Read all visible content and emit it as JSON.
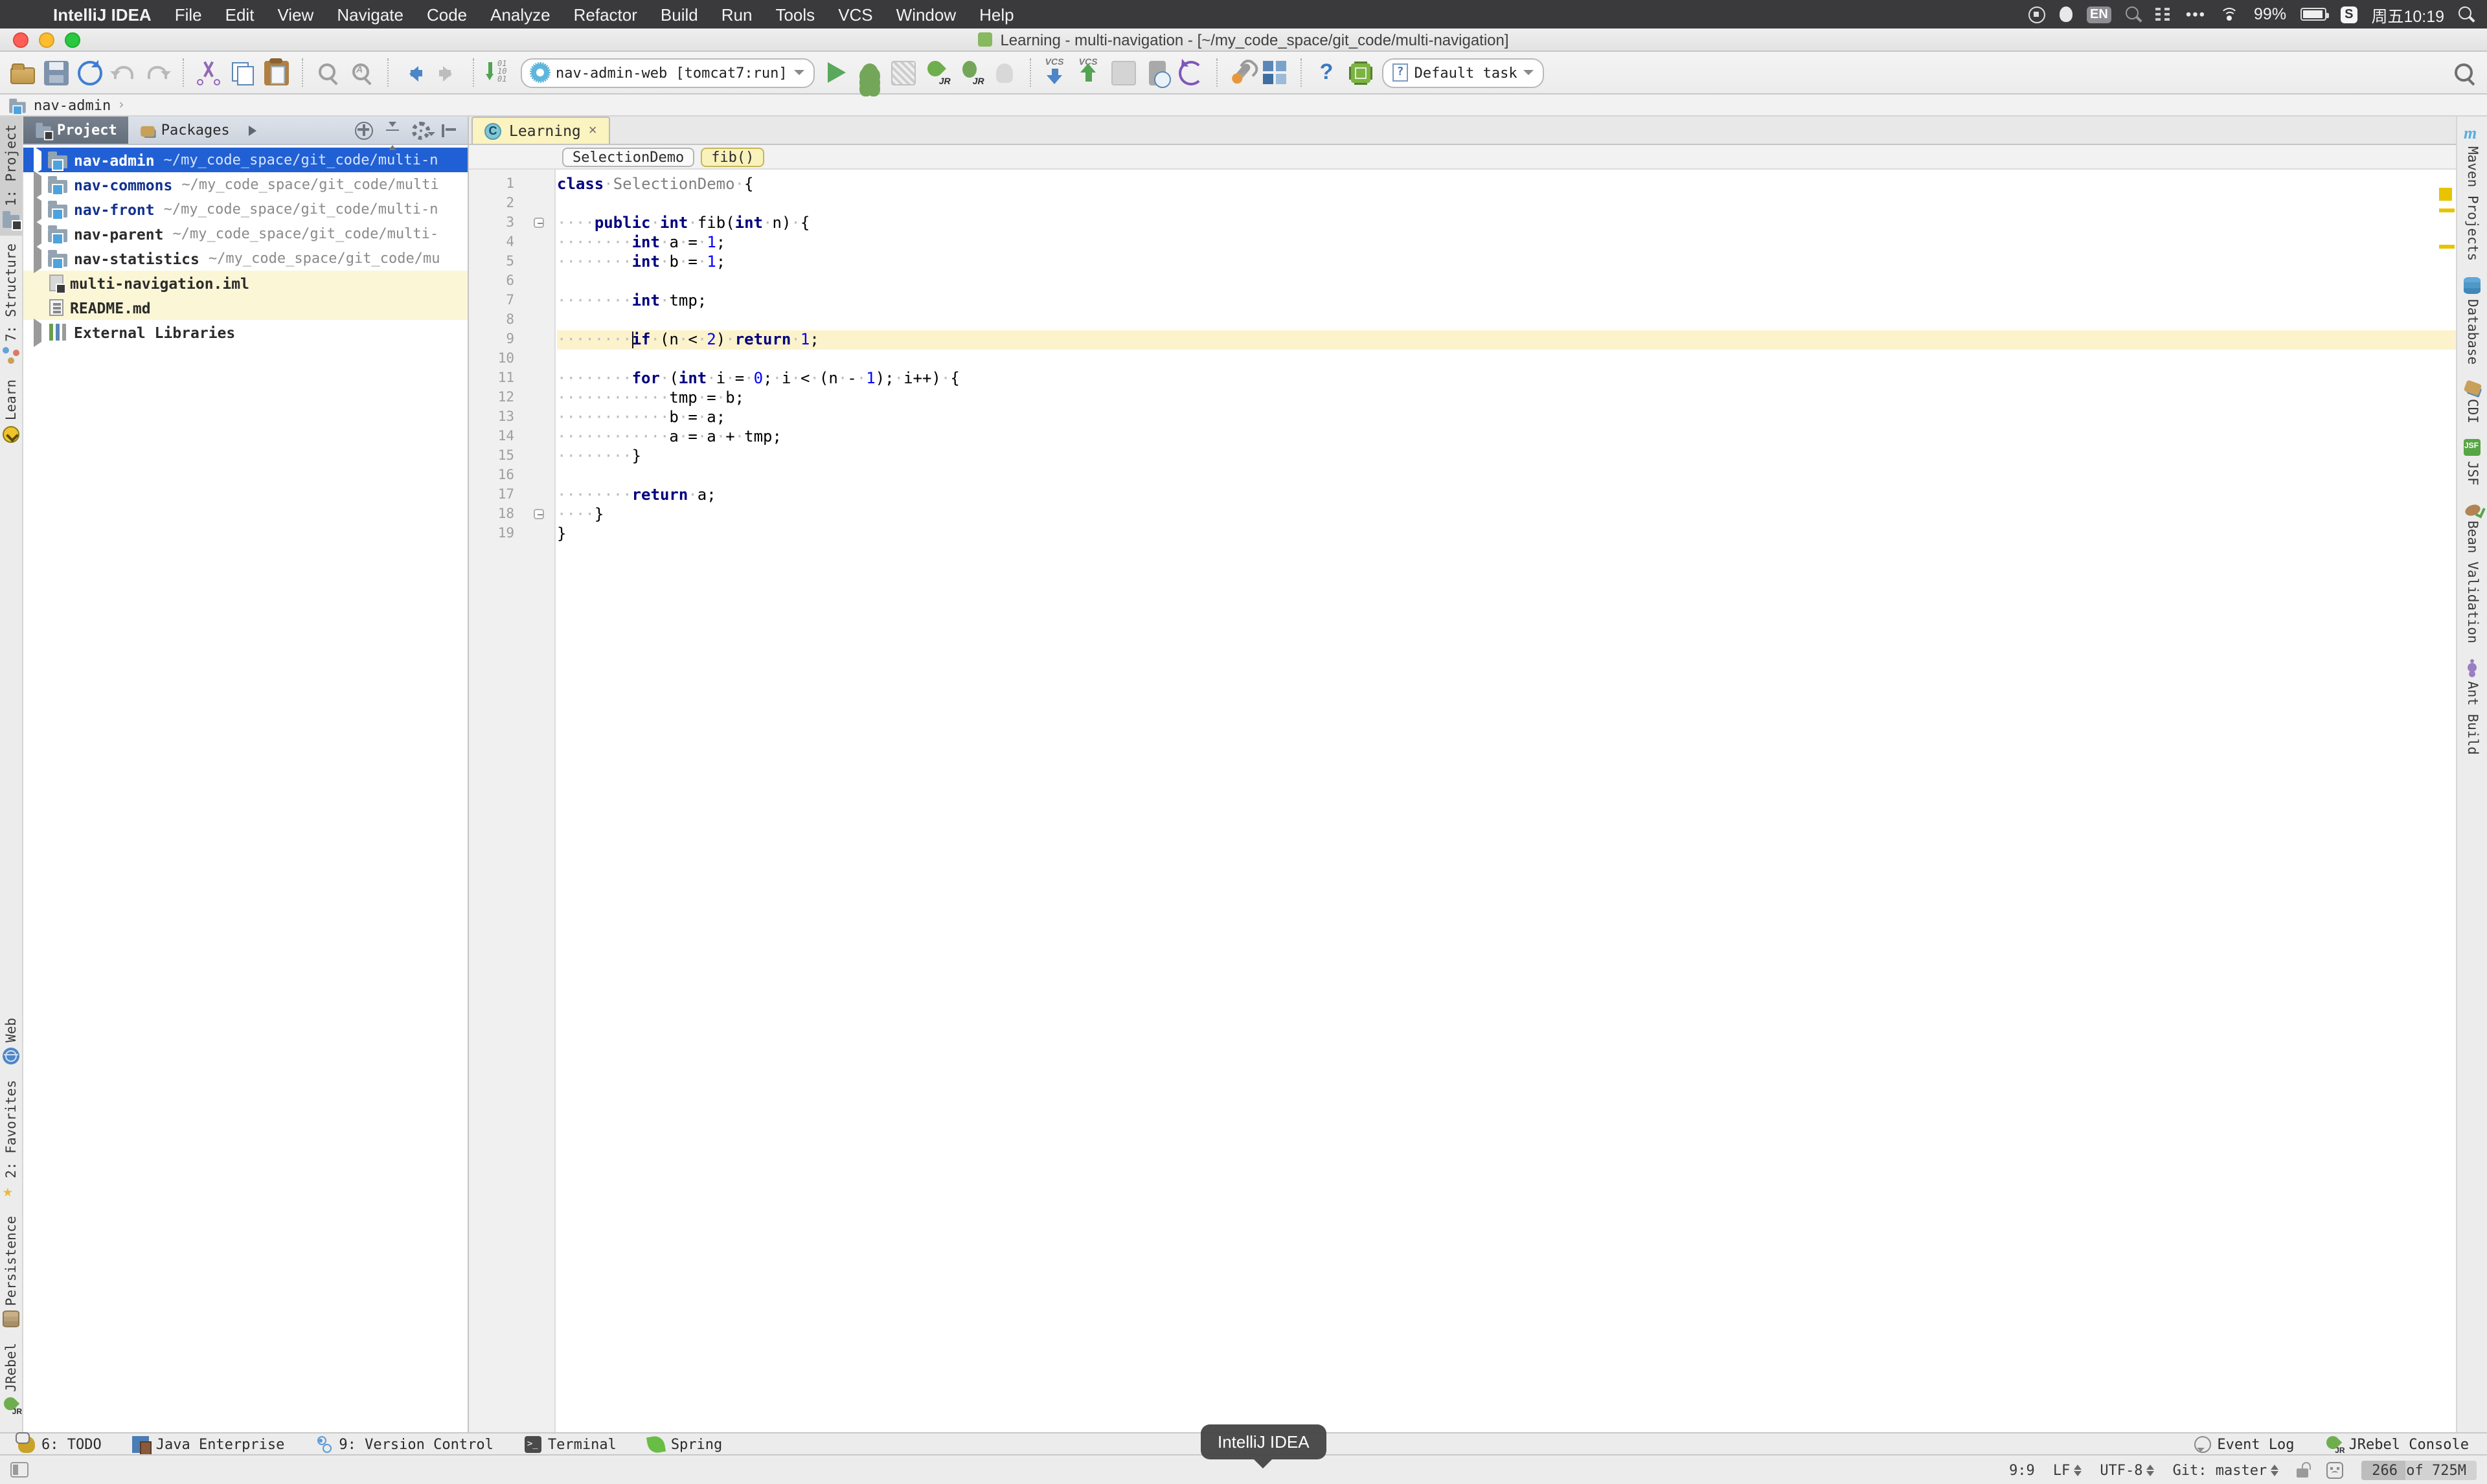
{
  "menubar": {
    "apple": "",
    "items": [
      "IntelliJ IDEA",
      "File",
      "Edit",
      "View",
      "Navigate",
      "Code",
      "Analyze",
      "Refactor",
      "Build",
      "Run",
      "Tools",
      "VCS",
      "Window",
      "Help"
    ],
    "status": {
      "input_badge": "EN",
      "more_dots": "•••",
      "battery_percent": "99%",
      "ime_badge": "S",
      "clock": "周五10:19"
    }
  },
  "titlebar": {
    "title": "Learning - multi-navigation - [~/my_code_space/git_code/multi-navigation]"
  },
  "toolbar": {
    "run_config_label": "nav-admin-web [tomcat7:run]",
    "task_selector_label": "Default task",
    "left_icons": [
      "open",
      "save",
      "sync",
      "undo",
      "redo",
      "|",
      "cut",
      "copy",
      "paste",
      "|",
      "find",
      "replace",
      "|",
      "back",
      "forward",
      "|",
      "sort"
    ],
    "run_icons": [
      "run",
      "debug",
      "coverage",
      "jrebel-run",
      "jrebel-debug",
      "profile-disabled",
      "|",
      "vcs-update",
      "vcs-commit",
      "vcs-disabled",
      "history",
      "rollback",
      "|",
      "settings",
      "project-structure",
      "|",
      "help",
      "memory-chip"
    ]
  },
  "navbar": {
    "path": "nav-admin",
    "chevron": "›"
  },
  "project_panel": {
    "tabs": [
      {
        "label": "Project",
        "selected": true
      },
      {
        "label": "Packages",
        "selected": false
      }
    ],
    "tree": [
      {
        "type": "module",
        "name": "nav-admin",
        "path": "~/my_code_space/git_code/multi-n",
        "selected": true,
        "arrow": true
      },
      {
        "type": "module",
        "name": "nav-commons",
        "path": "~/my_code_space/git_code/multi",
        "name_color": "blue",
        "arrow": true
      },
      {
        "type": "module",
        "name": "nav-front",
        "path": "~/my_code_space/git_code/multi-n",
        "name_color": "blue",
        "arrow": true
      },
      {
        "type": "module",
        "name": "nav-parent",
        "path": "~/my_code_space/git_code/multi-",
        "arrow": true
      },
      {
        "type": "module",
        "name": "nav-statistics",
        "path": "~/my_code_space/git_code/mu",
        "arrow": true
      },
      {
        "type": "iml",
        "name": "multi-navigation.iml",
        "path": "",
        "highlighted": true
      },
      {
        "type": "md",
        "name": "README.md",
        "path": "",
        "highlighted": true
      },
      {
        "type": "lib",
        "name": "External Libraries",
        "path": "",
        "arrow": true
      }
    ]
  },
  "editor": {
    "tab": {
      "label": "Learning",
      "close": "×",
      "class_letter": "C"
    },
    "breadcrumbs": [
      "SelectionDemo",
      "fib()"
    ],
    "code_lines": [
      {
        "n": "1",
        "seg": [
          [
            "k",
            "class"
          ],
          [
            "w",
            "·"
          ],
          [
            "g",
            "SelectionDemo"
          ],
          [
            "w",
            "·"
          ],
          [
            "d",
            "{"
          ]
        ]
      },
      {
        "n": "2",
        "seg": []
      },
      {
        "n": "3",
        "fold": true,
        "seg": [
          [
            "w",
            "····"
          ],
          [
            "k",
            "public"
          ],
          [
            "w",
            "·"
          ],
          [
            "k",
            "int"
          ],
          [
            "w",
            "·"
          ],
          [
            "d",
            "fib("
          ],
          [
            "k",
            "int"
          ],
          [
            "w",
            "·"
          ],
          [
            "d",
            "n)"
          ],
          [
            "w",
            "·"
          ],
          [
            "d",
            "{"
          ]
        ]
      },
      {
        "n": "4",
        "seg": [
          [
            "w",
            "········"
          ],
          [
            "k",
            "int"
          ],
          [
            "w",
            "·"
          ],
          [
            "d",
            "a"
          ],
          [
            "w",
            "·"
          ],
          [
            "d",
            "="
          ],
          [
            "w",
            "·"
          ],
          [
            "n",
            "1"
          ],
          [
            "d",
            ";"
          ]
        ]
      },
      {
        "n": "5",
        "seg": [
          [
            "w",
            "········"
          ],
          [
            "k",
            "int"
          ],
          [
            "w",
            "·"
          ],
          [
            "d",
            "b"
          ],
          [
            "w",
            "·"
          ],
          [
            "d",
            "="
          ],
          [
            "w",
            "·"
          ],
          [
            "n",
            "1"
          ],
          [
            "d",
            ";"
          ]
        ]
      },
      {
        "n": "6",
        "seg": []
      },
      {
        "n": "7",
        "seg": [
          [
            "w",
            "········"
          ],
          [
            "k",
            "int"
          ],
          [
            "w",
            "·"
          ],
          [
            "d",
            "tmp;"
          ]
        ]
      },
      {
        "n": "8",
        "seg": []
      },
      {
        "n": "9",
        "hl": true,
        "caret": true,
        "seg": [
          [
            "w",
            "········"
          ],
          [
            "k",
            "if"
          ],
          [
            "w",
            "·"
          ],
          [
            "d",
            "(n"
          ],
          [
            "w",
            "·"
          ],
          [
            "d",
            "<"
          ],
          [
            "w",
            "·"
          ],
          [
            "n",
            "2"
          ],
          [
            "d",
            ")"
          ],
          [
            "w",
            "·"
          ],
          [
            "k",
            "return"
          ],
          [
            "w",
            "·"
          ],
          [
            "n",
            "1"
          ],
          [
            "d",
            ";"
          ]
        ]
      },
      {
        "n": "10",
        "seg": []
      },
      {
        "n": "11",
        "seg": [
          [
            "w",
            "········"
          ],
          [
            "k",
            "for"
          ],
          [
            "w",
            "·"
          ],
          [
            "d",
            "("
          ],
          [
            "k",
            "int"
          ],
          [
            "w",
            "·"
          ],
          [
            "d",
            "i"
          ],
          [
            "w",
            "·"
          ],
          [
            "d",
            "="
          ],
          [
            "w",
            "·"
          ],
          [
            "n",
            "0"
          ],
          [
            "d",
            ";"
          ],
          [
            "w",
            "·"
          ],
          [
            "d",
            "i"
          ],
          [
            "w",
            "·"
          ],
          [
            "d",
            "<"
          ],
          [
            "w",
            "·"
          ],
          [
            "d",
            "(n"
          ],
          [
            "w",
            "·"
          ],
          [
            "d",
            "-"
          ],
          [
            "w",
            "·"
          ],
          [
            "n",
            "1"
          ],
          [
            "d",
            ");"
          ],
          [
            "w",
            "·"
          ],
          [
            "d",
            "i++)"
          ],
          [
            "w",
            "·"
          ],
          [
            "d",
            "{"
          ]
        ]
      },
      {
        "n": "12",
        "seg": [
          [
            "w",
            "············"
          ],
          [
            "d",
            "tmp"
          ],
          [
            "w",
            "·"
          ],
          [
            "d",
            "="
          ],
          [
            "w",
            "·"
          ],
          [
            "d",
            "b;"
          ]
        ]
      },
      {
        "n": "13",
        "seg": [
          [
            "w",
            "············"
          ],
          [
            "d",
            "b"
          ],
          [
            "w",
            "·"
          ],
          [
            "d",
            "="
          ],
          [
            "w",
            "·"
          ],
          [
            "d",
            "a;"
          ]
        ]
      },
      {
        "n": "14",
        "seg": [
          [
            "w",
            "············"
          ],
          [
            "d",
            "a"
          ],
          [
            "w",
            "·"
          ],
          [
            "d",
            "="
          ],
          [
            "w",
            "·"
          ],
          [
            "d",
            "a"
          ],
          [
            "w",
            "·"
          ],
          [
            "d",
            "+"
          ],
          [
            "w",
            "·"
          ],
          [
            "d",
            "tmp;"
          ]
        ]
      },
      {
        "n": "15",
        "seg": [
          [
            "w",
            "········"
          ],
          [
            "d",
            "}"
          ]
        ]
      },
      {
        "n": "16",
        "seg": []
      },
      {
        "n": "17",
        "seg": [
          [
            "w",
            "········"
          ],
          [
            "k",
            "return"
          ],
          [
            "w",
            "·"
          ],
          [
            "d",
            "a;"
          ]
        ]
      },
      {
        "n": "18",
        "fold": true,
        "seg": [
          [
            "w",
            "····"
          ],
          [
            "d",
            "}"
          ]
        ]
      },
      {
        "n": "19",
        "seg": [
          [
            "d",
            "}"
          ]
        ]
      }
    ]
  },
  "stripes": {
    "left_top": [
      {
        "label": "1: Project",
        "icon": "project",
        "active": true
      },
      {
        "label": "7: Structure",
        "icon": "structure"
      },
      {
        "label": "Learn",
        "icon": "learn"
      }
    ],
    "left_bottom": [
      {
        "label": "Web",
        "icon": "web"
      },
      {
        "label": "2: Favorites",
        "icon": "star"
      },
      {
        "label": "Persistence",
        "icon": "db"
      },
      {
        "label": "JRebel",
        "icon": "jrebel"
      }
    ],
    "right": [
      {
        "label": "Maven Projects",
        "icon": "maven"
      },
      {
        "label": "Database",
        "icon": "db2"
      },
      {
        "label": "CDI",
        "icon": "cdi"
      },
      {
        "label": "JSF",
        "icon": "jsf"
      },
      {
        "label": "Bean Validation",
        "icon": "bean"
      },
      {
        "label": "Ant Build",
        "icon": "ant"
      }
    ]
  },
  "bottom_bar": {
    "left": [
      {
        "label": "6: TODO",
        "icon": "todo"
      },
      {
        "label": "Java Enterprise",
        "icon": "jee"
      },
      {
        "label": "9: Version Control",
        "icon": "vc"
      },
      {
        "label": "Terminal",
        "icon": "term"
      },
      {
        "label": "Spring",
        "icon": "spring"
      }
    ],
    "right": [
      {
        "label": "Event Log",
        "icon": "eventlog"
      },
      {
        "label": "JRebel Console",
        "icon": "jrc"
      }
    ]
  },
  "statusbar": {
    "position": "9:9",
    "line_ending": "LF",
    "encoding": "UTF-8",
    "vcs": "Git: master",
    "memory": "266 of 725M"
  },
  "dock_tooltip": {
    "text": "IntelliJ IDEA"
  },
  "colors": {
    "selection_blue": "#2160d4",
    "caret_line": "#fcf3cd",
    "modified_row_yellow": "#fbf6d5",
    "keyword_navy": "#000080",
    "number_blue": "#0000ff",
    "stripe_mark_yellow": "#e8c400"
  }
}
